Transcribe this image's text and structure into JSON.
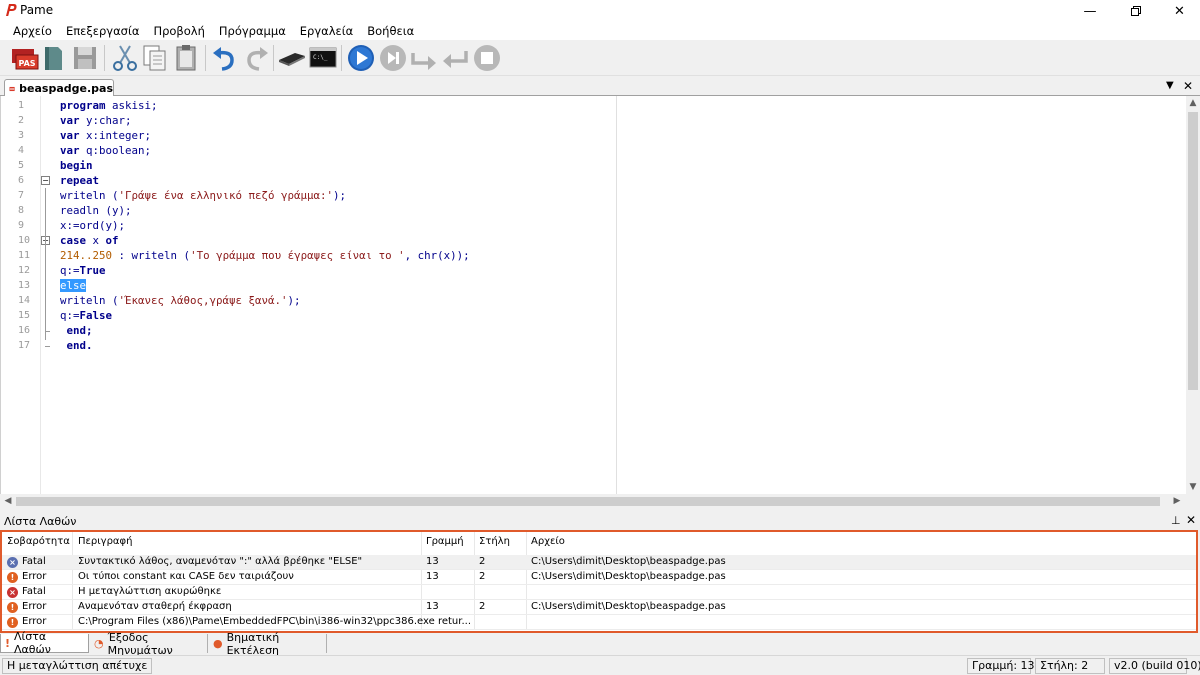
{
  "window": {
    "title": "Pame"
  },
  "menu": [
    "Αρχείο",
    "Επεξεργασία",
    "Προβολή",
    "Πρόγραμμα",
    "Εργαλεία",
    "Βοήθεια"
  ],
  "toolbar": {
    "icons": [
      "new-pas-icon",
      "open-icon",
      "save-icon",
      "cut-icon",
      "copy-icon",
      "paste-icon",
      "undo-icon",
      "redo-icon",
      "compile-icon",
      "console-icon",
      "run-icon",
      "step-icon",
      "step-over-icon",
      "step-out-icon",
      "stop-icon"
    ],
    "new_badge": "PAS"
  },
  "tab": {
    "filename": "beaspadge.pas"
  },
  "editor": {
    "line_numbers": [
      "1",
      "2",
      "3",
      "4",
      "5",
      "6",
      "7",
      "8",
      "9",
      "10",
      "11",
      "12",
      "13",
      "14",
      "15",
      "16",
      "17"
    ],
    "lines": [
      [
        {
          "t": "program ",
          "c": "kw"
        },
        {
          "t": "askisi;",
          "c": "fn"
        }
      ],
      [
        {
          "t": "var ",
          "c": "kw"
        },
        {
          "t": "y:",
          "c": "fn"
        },
        {
          "t": "char",
          "c": "fn"
        },
        {
          "t": ";",
          "c": "fn"
        }
      ],
      [
        {
          "t": "var ",
          "c": "kw"
        },
        {
          "t": "x:integer;",
          "c": "fn"
        }
      ],
      [
        {
          "t": "var ",
          "c": "kw"
        },
        {
          "t": "q:boolean;",
          "c": "fn"
        }
      ],
      [
        {
          "t": "begin",
          "c": "kw"
        }
      ],
      [
        {
          "t": "repeat",
          "c": "kw"
        }
      ],
      [
        {
          "t": "writeln ",
          "c": "fn"
        },
        {
          "t": "(",
          "c": "fn"
        },
        {
          "t": "'Γράψε ένα ελληνικό πεζό γράμμα:'",
          "c": "str"
        },
        {
          "t": ");",
          "c": "fn"
        }
      ],
      [
        {
          "t": "readln ",
          "c": "fn"
        },
        {
          "t": "(y);",
          "c": "fn"
        }
      ],
      [
        {
          "t": "x:=",
          "c": "fn"
        },
        {
          "t": "ord",
          "c": "fn"
        },
        {
          "t": "(y);",
          "c": "fn"
        }
      ],
      [
        {
          "t": "case ",
          "c": "kw"
        },
        {
          "t": "x ",
          "c": "fn"
        },
        {
          "t": "of",
          "c": "kw"
        }
      ],
      [
        {
          "t": "214..250",
          "c": "num"
        },
        {
          "t": " : ",
          "c": "fn"
        },
        {
          "t": "writeln ",
          "c": "fn"
        },
        {
          "t": "(",
          "c": "fn"
        },
        {
          "t": "'Το γράμμα που έγραψες είναι το '",
          "c": "str"
        },
        {
          "t": ", ",
          "c": "fn"
        },
        {
          "t": "chr",
          "c": "fn"
        },
        {
          "t": "(x));",
          "c": "fn"
        }
      ],
      [
        {
          "t": "q:=",
          "c": "fn"
        },
        {
          "t": "True",
          "c": "kw"
        }
      ],
      [
        {
          "t": "else",
          "c": "hl"
        }
      ],
      [
        {
          "t": "writeln ",
          "c": "fn"
        },
        {
          "t": "(",
          "c": "fn"
        },
        {
          "t": "'Έκανες λάθος,γράψε ξανά.'",
          "c": "str"
        },
        {
          "t": ");",
          "c": "fn"
        }
      ],
      [
        {
          "t": "q:=",
          "c": "fn"
        },
        {
          "t": "False",
          "c": "kw"
        }
      ],
      [
        {
          "t": " end;",
          "c": "kw"
        }
      ],
      [
        {
          "t": " end.",
          "c": "kw"
        }
      ]
    ]
  },
  "errors": {
    "title": "Λίστα Λαθών",
    "columns": [
      "Σοβαρότητα",
      "Περιγραφή",
      "Γραμμή",
      "Στήλη",
      "Αρχείο"
    ],
    "rows": [
      {
        "severity": "Fatal",
        "icon": "fatal-blue",
        "description": "Συντακτικό λάθος, αναμενόταν \":\" αλλά βρέθηκε \"ELSE\"",
        "line": "13",
        "col": "2",
        "file": "C:\\Users\\dimit\\Desktop\\beaspadge.pas"
      },
      {
        "severity": "Error",
        "icon": "error",
        "description": "Οι τύποι constant και CASE δεν ταιριάζουν",
        "line": "13",
        "col": "2",
        "file": "C:\\Users\\dimit\\Desktop\\beaspadge.pas"
      },
      {
        "severity": "Fatal",
        "icon": "fatal",
        "description": "Η μεταγλώττιση ακυρώθηκε",
        "line": "",
        "col": "",
        "file": ""
      },
      {
        "severity": "Error",
        "icon": "error",
        "description": "Αναμενόταν σταθερή έκφραση",
        "line": "13",
        "col": "2",
        "file": "C:\\Users\\dimit\\Desktop\\beaspadge.pas"
      },
      {
        "severity": "Error",
        "icon": "error",
        "description": "C:\\Program Files (x86)\\Pame\\EmbeddedFPC\\bin\\i386-win32\\ppc386.exe retur...",
        "line": "",
        "col": "",
        "file": ""
      }
    ]
  },
  "bottom_tabs": [
    "Λίστα Λαθών",
    "Έξοδος Μηνυμάτων",
    "Βηματική Εκτέλεση"
  ],
  "status": {
    "message": "Η μεταγλώττιση απέτυχε",
    "line": "Γραμμή: 13",
    "column": "Στήλη: 2",
    "version": "v2.0 (build 010)"
  },
  "colors": {
    "accent": "#e05a2b",
    "keyword": "#00008b",
    "string": "#8b1a1a",
    "number": "#b25c00",
    "selection": "#3399ff"
  }
}
